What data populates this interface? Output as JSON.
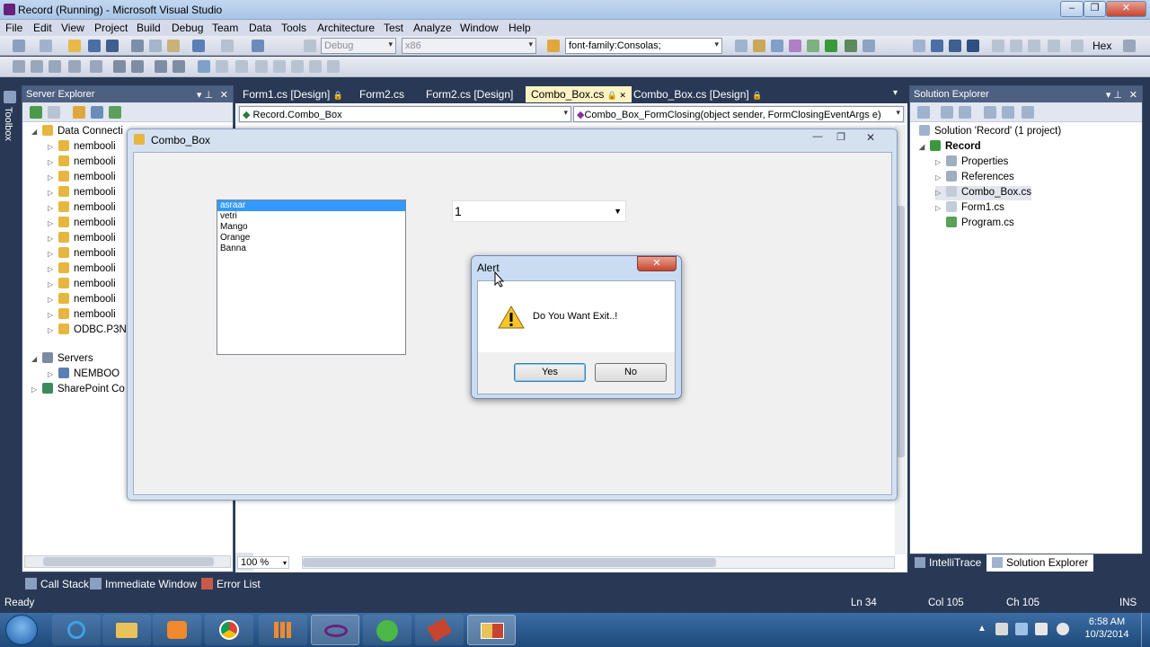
{
  "window": {
    "title": "Record (Running) - Microsoft Visual Studio"
  },
  "menu": [
    "File",
    "Edit",
    "View",
    "Project",
    "Build",
    "Debug",
    "Team",
    "Data",
    "Tools",
    "Architecture",
    "Test",
    "Analyze",
    "Window",
    "Help"
  ],
  "toolbar": {
    "config": "Debug",
    "platform": "x86",
    "find_text": "font-family:Consolas;",
    "hex_label": "Hex"
  },
  "server_explorer": {
    "title": "Server Explorer",
    "data_connections_label": "Data Connecti",
    "connections": [
      "nembooli",
      "nembooli",
      "nembooli",
      "nembooli",
      "nembooli",
      "nembooli",
      "nembooli",
      "nembooli",
      "nembooli",
      "nembooli",
      "nembooli",
      "nembooli"
    ],
    "odbc_label": "ODBC.P3N",
    "servers_label": "Servers",
    "server_item": "NEMBOO",
    "sharepoint_label": "SharePoint Co"
  },
  "toolbox_label": "Toolbox",
  "doc_tabs": [
    {
      "label": "Form1.cs [Design]"
    },
    {
      "label": "Form2.cs"
    },
    {
      "label": "Form2.cs [Design]"
    },
    {
      "label": "Combo_Box.cs"
    },
    {
      "label": "Combo_Box.cs [Design]"
    }
  ],
  "navbar": {
    "type": "Record.Combo_Box",
    "member": "Combo_Box_FormClosing(object sender, FormClosingEventArgs e)"
  },
  "zoom": "100 %",
  "solution_explorer": {
    "title": "Solution Explorer",
    "solution": "Solution 'Record' (1 project)",
    "project": "Record",
    "items": [
      "Properties",
      "References",
      "Combo_Box.cs",
      "Form1.cs",
      "Program.cs"
    ],
    "tab_intellitrace": "IntelliTrace",
    "tab_solution": "Solution Explorer"
  },
  "bottom_tabs": [
    "Call Stack",
    "Immediate Window",
    "Error List"
  ],
  "status": {
    "ready": "Ready",
    "ln": "Ln 34",
    "col": "Col 105",
    "ch": "Ch 105",
    "ins": "INS"
  },
  "form": {
    "title": "Combo_Box",
    "list_items": [
      "asraar",
      "vetri",
      "Mango",
      "Orange",
      "Banna"
    ],
    "combo_value": "1"
  },
  "alert": {
    "title": "Alert",
    "message": "Do You Want Exit..!",
    "yes": "Yes",
    "no": "No"
  },
  "clock": {
    "time": "6:58 AM",
    "date": "10/3/2014"
  }
}
